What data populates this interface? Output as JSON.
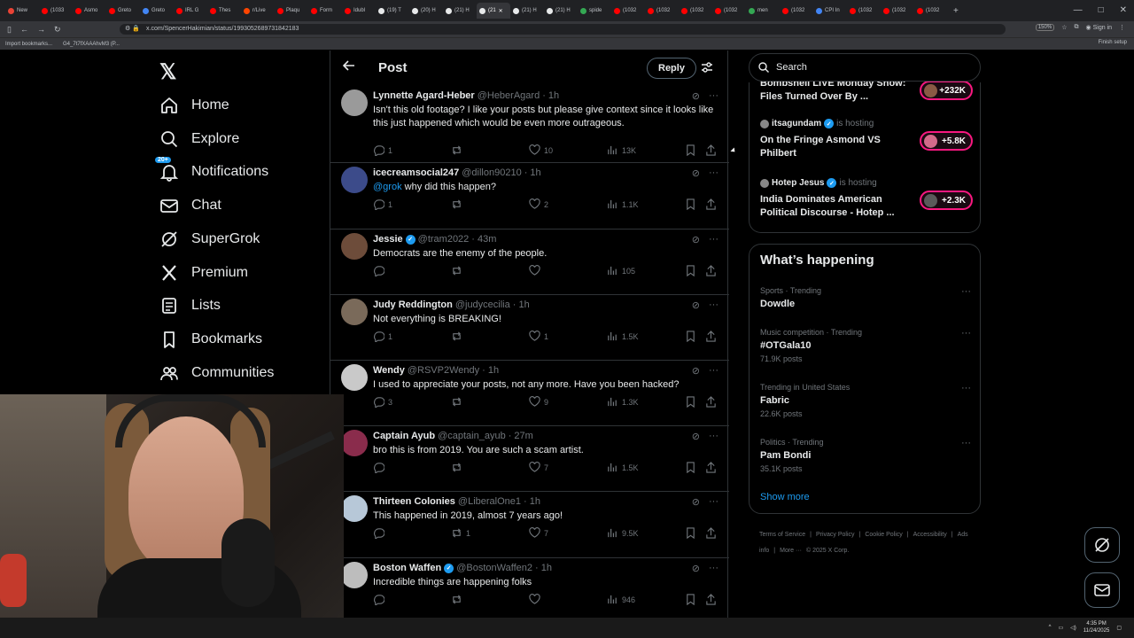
{
  "browser": {
    "tabs": [
      {
        "label": "New",
        "color": "#ea4335",
        "active": false
      },
      {
        "label": "(1033",
        "color": "#ff0000",
        "active": false
      },
      {
        "label": "Asmo",
        "color": "#ff0000",
        "active": false
      },
      {
        "label": "Greto",
        "color": "#ff0000",
        "active": false
      },
      {
        "label": "Greto",
        "color": "#4285f4",
        "active": false
      },
      {
        "label": "IRL G",
        "color": "#ff0000",
        "active": false
      },
      {
        "label": "Thes",
        "color": "#ff0000",
        "active": false
      },
      {
        "label": "r/Live",
        "color": "#ff4500",
        "active": false
      },
      {
        "label": "Plaqu",
        "color": "#ff0000",
        "active": false
      },
      {
        "label": "Form",
        "color": "#ff0000",
        "active": false
      },
      {
        "label": "Idubl",
        "color": "#ff0000",
        "active": false
      },
      {
        "label": "(19) T",
        "color": "#e7e9ea",
        "active": false
      },
      {
        "label": "(20) H",
        "color": "#e7e9ea",
        "active": false
      },
      {
        "label": "(21) H",
        "color": "#e7e9ea",
        "active": false
      },
      {
        "label": "(21",
        "color": "#e7e9ea",
        "active": true
      },
      {
        "label": "(21) H",
        "color": "#e7e9ea",
        "active": false
      },
      {
        "label": "(21) H",
        "color": "#e7e9ea",
        "active": false
      },
      {
        "label": "spide",
        "color": "#34a853",
        "active": false
      },
      {
        "label": "(1032",
        "color": "#ff0000",
        "active": false
      },
      {
        "label": "(1032",
        "color": "#ff0000",
        "active": false
      },
      {
        "label": "(1032",
        "color": "#ff0000",
        "active": false
      },
      {
        "label": "(1032",
        "color": "#ff0000",
        "active": false
      },
      {
        "label": "men",
        "color": "#34a853",
        "active": false
      },
      {
        "label": "(1032",
        "color": "#ff0000",
        "active": false
      },
      {
        "label": "CPI In",
        "color": "#4285f4",
        "active": false
      },
      {
        "label": "(1032",
        "color": "#ff0000",
        "active": false
      },
      {
        "label": "(1032",
        "color": "#ff0000",
        "active": false
      },
      {
        "label": "(1032",
        "color": "#ff0000",
        "active": false
      }
    ],
    "new_tab": "+",
    "url": "x.com/SpencerHakimian/status/1993052689731842183",
    "zoom": "150%",
    "sign_in": "Sign in",
    "bookmarks": [
      "Import bookmarks...",
      "G4_7t7fXAAAhvM3 (P..."
    ],
    "finish_setup": "Finish setup"
  },
  "nav": {
    "logo": "𝕏",
    "items": [
      {
        "label": "Home",
        "icon": "home-icon"
      },
      {
        "label": "Explore",
        "icon": "search-icon"
      },
      {
        "label": "Notifications",
        "icon": "bell-icon",
        "badge": "20+"
      },
      {
        "label": "Chat",
        "icon": "mail-icon"
      },
      {
        "label": "SuperGrok",
        "icon": "grok-icon"
      },
      {
        "label": "Premium",
        "icon": "x-icon"
      },
      {
        "label": "Lists",
        "icon": "list-icon"
      },
      {
        "label": "Bookmarks",
        "icon": "bookmark-icon"
      },
      {
        "label": "Communities",
        "icon": "people-icon"
      }
    ]
  },
  "header": {
    "title": "Post",
    "reply": "Reply"
  },
  "tweets": [
    {
      "name": "Lynnette Agard-Heber",
      "handle": "@HeberAgard",
      "time": "· 1h",
      "verified": false,
      "text": "Isn't this old footage? I like your posts but please give context since it looks like this just happened which would be even more outrageous.",
      "replies": "1",
      "reposts": "",
      "likes": "10",
      "views": "13K",
      "avatar": "#9a9a9a"
    },
    {
      "name": "icecreamsocial247",
      "handle": "@dillon90210",
      "time": "· 1h",
      "verified": false,
      "mention": "@grok",
      "text": " why did this happen?",
      "replies": "1",
      "reposts": "",
      "likes": "2",
      "views": "1.1K",
      "avatar": "#3c4b8a"
    },
    {
      "name": "Jessie",
      "handle": "@tram2022",
      "time": "· 43m",
      "verified": true,
      "text": "Democrats are the enemy of the people.",
      "replies": "",
      "reposts": "",
      "likes": "",
      "views": "105",
      "avatar": "#6d4c3a"
    },
    {
      "name": "Judy Reddington",
      "handle": "@judycecilia",
      "time": "· 1h",
      "verified": false,
      "text": "Not everything is BREAKING!",
      "replies": "1",
      "reposts": "",
      "likes": "1",
      "views": "1.5K",
      "avatar": "#7a6a5a"
    },
    {
      "name": "Wendy",
      "handle": "@RSVP2Wendy",
      "time": "· 1h",
      "verified": false,
      "text": "I used to appreciate your posts, not any more. Have you been hacked?",
      "replies": "3",
      "reposts": "",
      "likes": "9",
      "views": "1.3K",
      "avatar": "#c9c9c9"
    },
    {
      "name": "Captain Ayub",
      "handle": "@captain_ayub",
      "time": "· 27m",
      "verified": false,
      "text": "bro this is from 2019. You are such a scam artist.",
      "replies": "",
      "reposts": "",
      "likes": "7",
      "views": "1.5K",
      "avatar": "#8a2c4c"
    },
    {
      "name": "Thirteen Colonies",
      "handle": "@LiberalOne1",
      "time": "· 1h",
      "verified": false,
      "text": "This happened in 2019, almost 7 years ago!",
      "replies": "",
      "reposts": "1",
      "likes": "7",
      "views": "9.5K",
      "avatar": "#b7c8d8"
    },
    {
      "name": "Boston Waffen",
      "handle": "@BostonWaffen2",
      "time": "· 1h",
      "verified": true,
      "text": "Incredible things are happening folks",
      "replies": "",
      "reposts": "",
      "likes": "",
      "views": "946",
      "avatar": "#bdbdbd"
    }
  ],
  "search": {
    "placeholder": "Search"
  },
  "spaces": [
    {
      "host": "",
      "hosting": "",
      "title": "Bombshell LIVE Monday Show: Files Turned Over By ...",
      "count": "+232K"
    },
    {
      "host": "itsagundam",
      "hosting": "is hosting",
      "verified": true,
      "title": "On the Fringe Asmond VS Philbert",
      "count": "+5.8K"
    },
    {
      "host": "Hotep Jesus",
      "hosting": "is hosting",
      "verified": true,
      "title": "India Dominates American Political Discourse - Hotep ...",
      "count": "+2.3K"
    }
  ],
  "trending": {
    "title": "What’s happening",
    "items": [
      {
        "meta": "Sports · Trending",
        "name": "Dowdle",
        "count": ""
      },
      {
        "meta": "Music competition · Trending",
        "name": "#OTGala10",
        "count": "71.9K posts"
      },
      {
        "meta": "Trending in United States",
        "name": "Fabric",
        "count": "22.6K posts"
      },
      {
        "meta": "Politics · Trending",
        "name": "Pam Bondi",
        "count": "35.1K posts"
      }
    ],
    "show_more": "Show more"
  },
  "footer": {
    "links": [
      "Terms of Service",
      "|",
      "Privacy Policy",
      "|",
      "Cookie Policy",
      "|",
      "Accessibility",
      "|",
      "Ads info",
      "|",
      "More ···",
      "© 2025 X Corp."
    ]
  },
  "taskbar": {
    "time": "4:35 PM",
    "date": "11/24/2025"
  }
}
